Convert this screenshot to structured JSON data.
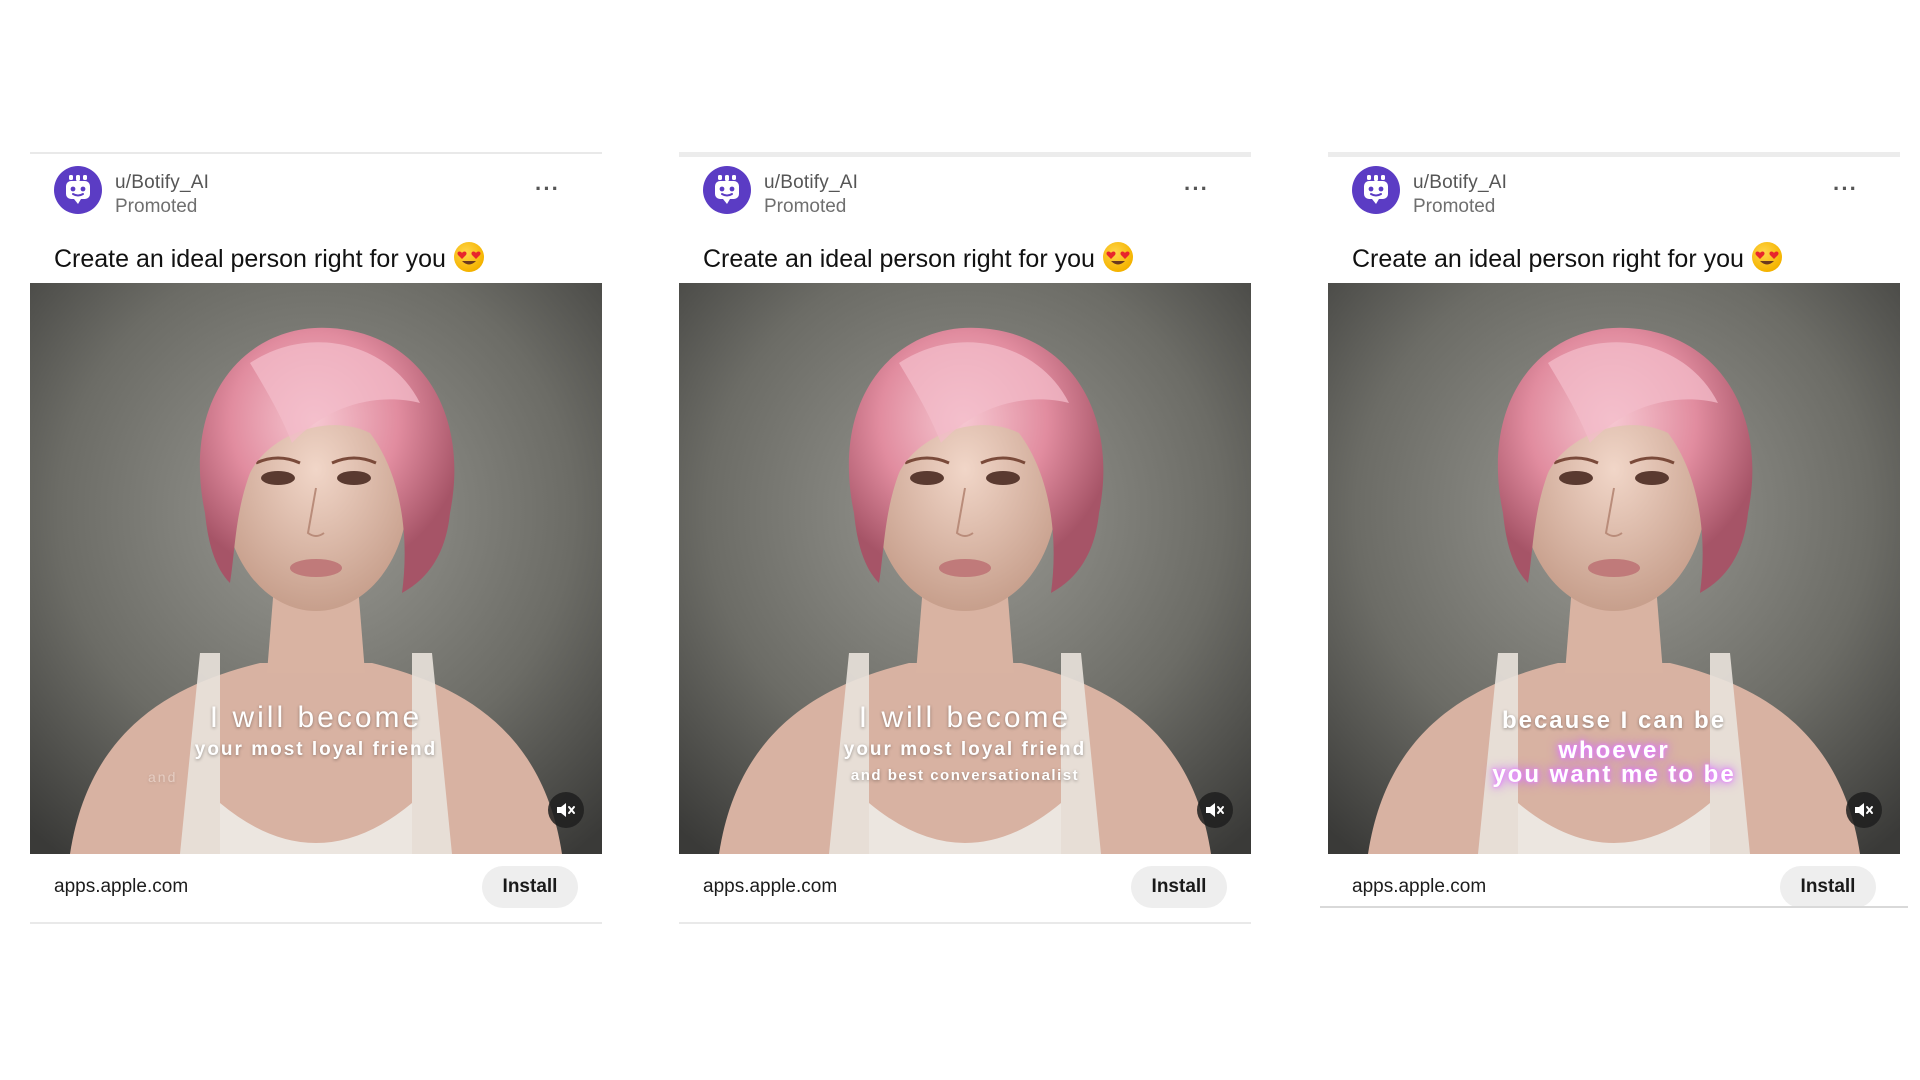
{
  "cards": [
    {
      "username": "u/Botify_AI",
      "promoted": "Promoted",
      "more": "···",
      "title": "Create an ideal person right for you",
      "caption_line1": "I will become",
      "caption_line2": "your most loyal friend",
      "caption_line3": "and",
      "domain": "apps.apple.com",
      "install": "Install"
    },
    {
      "username": "u/Botify_AI",
      "promoted": "Promoted",
      "more": "···",
      "title": "Create an ideal person right for you",
      "caption_line1": "I will become",
      "caption_line2": "your most loyal friend",
      "caption_line3": "and best conversationalist",
      "domain": "apps.apple.com",
      "install": "Install"
    },
    {
      "username": "u/Botify_AI",
      "promoted": "Promoted",
      "more": "···",
      "title": "Create an ideal person right for you",
      "caption_line1": "because I can be",
      "caption_line2": "whoever",
      "caption_line3": "you want me to be",
      "domain": "apps.apple.com",
      "install": "Install"
    }
  ],
  "icons": {
    "avatar": "robot-avatar-icon",
    "emoji": "heart-eyes-emoji-icon",
    "mute": "muted-speaker-icon",
    "more": "more-options-icon"
  },
  "colors": {
    "avatar_bg": "#5b3cc4",
    "hair_pink": "#e7a0b0",
    "install_bg": "#eeeeee",
    "glow": "#c05aff"
  }
}
